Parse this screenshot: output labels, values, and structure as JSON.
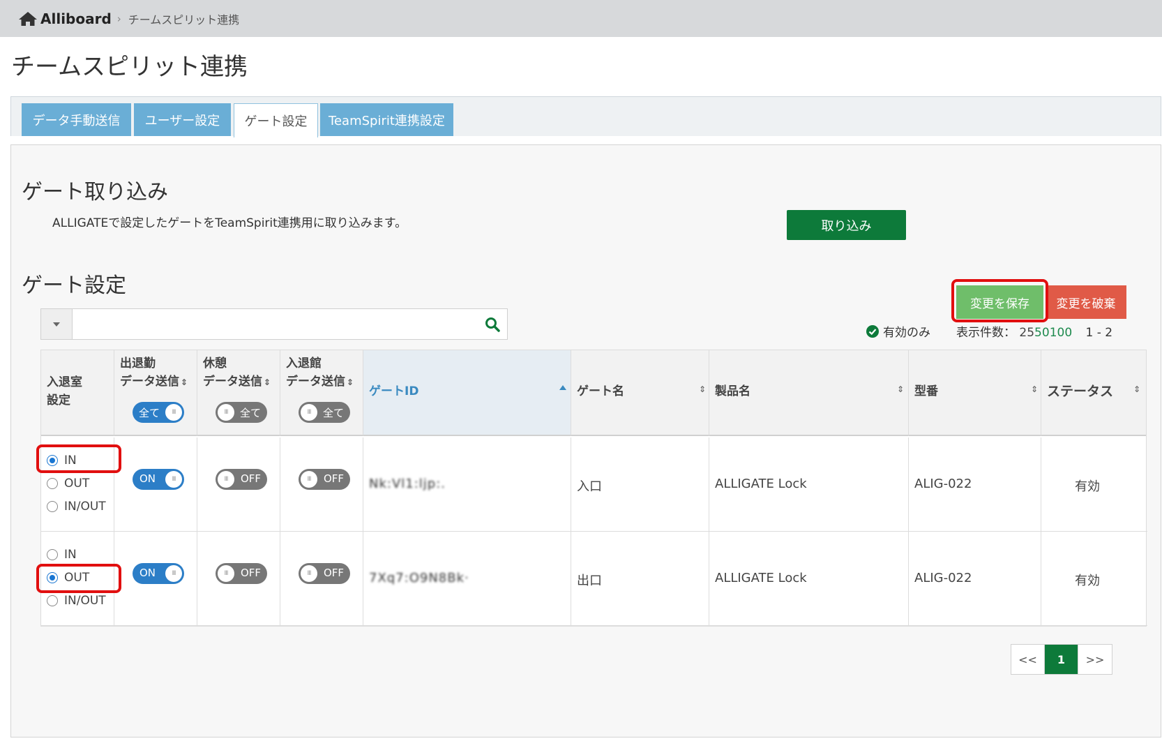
{
  "breadcrumb": {
    "brand": "Alliboard",
    "sep": "›",
    "current": "チームスピリット連携"
  },
  "page_title": "チームスピリット連携",
  "tabs": [
    {
      "label": "データ手動送信"
    },
    {
      "label": "ユーザー設定"
    },
    {
      "label": "ゲート設定"
    },
    {
      "label": "TeamSpirit連携設定"
    }
  ],
  "import_section": {
    "title": "ゲート取り込み",
    "description": "ALLIGATEで設定したゲートをTeamSpirit連携用に取り込みます。",
    "button": "取り込み"
  },
  "gate_section": {
    "title": "ゲート設定",
    "save_button": "変更を保存",
    "discard_button": "変更を破棄",
    "search_placeholder": "",
    "filter_label": "有効のみ",
    "count_label": "表示件数：",
    "count_opt1": "25",
    "count_opt2": "50",
    "count_opt3": "100",
    "range": "1 - 2"
  },
  "table": {
    "headers": {
      "io": [
        "入退室",
        "設定"
      ],
      "attendance": [
        "出退勤",
        "データ送信"
      ],
      "break": [
        "休憩",
        "データ送信"
      ],
      "building": [
        "入退館",
        "データ送信"
      ],
      "gate_id": "ゲートID",
      "gate_name": "ゲート名",
      "product": "製品名",
      "model": "型番",
      "status": "ステータス"
    },
    "header_toggle": "全て",
    "radio_options": [
      "IN",
      "OUT",
      "IN/OUT"
    ],
    "rows": [
      {
        "selected": "IN",
        "attendance": "ON",
        "break": "OFF",
        "building": "OFF",
        "gate_id": "Nk:Vl1:ljp:.",
        "gate_name": "入口",
        "product": "ALLIGATE Lock",
        "model": "ALIG-022",
        "status": "有効"
      },
      {
        "selected": "OUT",
        "attendance": "ON",
        "break": "OFF",
        "building": "OFF",
        "gate_id": "7Xq7:O9N8Bk·",
        "gate_name": "出口",
        "product": "ALLIGATE Lock",
        "model": "ALIG-022",
        "status": "有効"
      }
    ]
  },
  "pagination": {
    "prev": "<<",
    "current": "1",
    "next": ">>"
  },
  "colors": {
    "accent_green": "#0d7a3a",
    "save_green": "#6fbe6a",
    "discard_red": "#e05a47",
    "toggle_blue": "#2c7ec7",
    "tab_blue": "#6aaed6",
    "highlight_red": "#e10f0f"
  }
}
